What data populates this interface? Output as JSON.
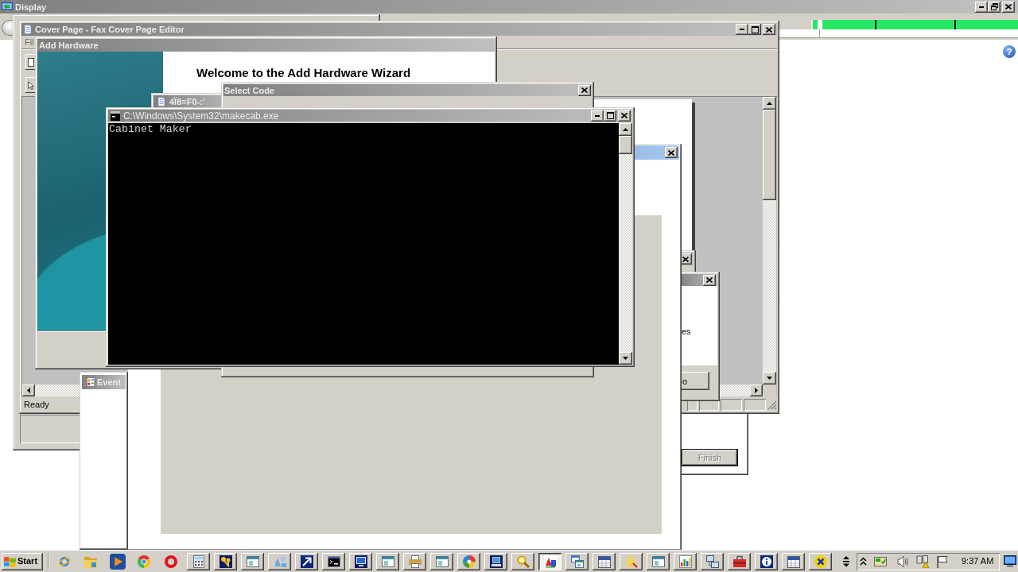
{
  "display_window": {
    "title": "Display",
    "help_button": "?"
  },
  "cover_page_window": {
    "title": "Cover Page - Fax Cover Page Editor",
    "menu": [
      {
        "label": "Fil"
      }
    ],
    "status_text": "Ready"
  },
  "add_hardware_window": {
    "title": "Add Hardware",
    "heading": "Welcome to the Add Hardware Wizard"
  },
  "background_window": {
    "title": "4Ï8=F0-:'"
  },
  "select_code_window": {
    "title": "Select Code"
  },
  "console_window": {
    "title": "C:\\Windows\\System32\\makecab.exe",
    "output": "Cabinet Maker"
  },
  "event_window": {
    "title": "Event"
  },
  "dialog_fragment": {
    "text": "es",
    "button": "o"
  },
  "wizard_fragment": {
    "buttons": [
      {
        "label": "Finish",
        "disabled": true
      }
    ]
  },
  "taskbar": {
    "start_button": "Start",
    "quick_launch": [
      {
        "kind": "globe"
      },
      {
        "kind": "folder"
      },
      {
        "kind": "player"
      },
      {
        "kind": "segments"
      },
      {
        "kind": "ring"
      }
    ],
    "tasks": [
      {
        "kind": "calculator",
        "selected": false
      },
      {
        "kind": "keys",
        "selected": false
      },
      {
        "kind": "window",
        "selected": false
      },
      {
        "kind": "shapes",
        "selected": false
      },
      {
        "kind": "arrow",
        "selected": false
      },
      {
        "kind": "console",
        "selected": false
      },
      {
        "kind": "monitor",
        "selected": false
      },
      {
        "kind": "window",
        "selected": false
      },
      {
        "kind": "printer",
        "selected": false
      },
      {
        "kind": "window",
        "selected": false
      },
      {
        "kind": "colorwheel",
        "selected": false
      },
      {
        "kind": "computer",
        "selected": false
      },
      {
        "kind": "magnifier",
        "selected": false
      },
      {
        "kind": "tiles",
        "selected": true
      },
      {
        "kind": "windows",
        "selected": false
      },
      {
        "kind": "calendar",
        "selected": false
      },
      {
        "kind": "hand",
        "selected": false
      },
      {
        "kind": "window",
        "selected": false
      },
      {
        "kind": "chart",
        "selected": false
      },
      {
        "kind": "network",
        "selected": false
      },
      {
        "kind": "toolbox",
        "selected": false
      },
      {
        "kind": "info",
        "selected": false
      },
      {
        "kind": "calendar",
        "selected": false
      },
      {
        "kind": "cross",
        "selected": false
      }
    ],
    "clock": "9:37 AM"
  }
}
